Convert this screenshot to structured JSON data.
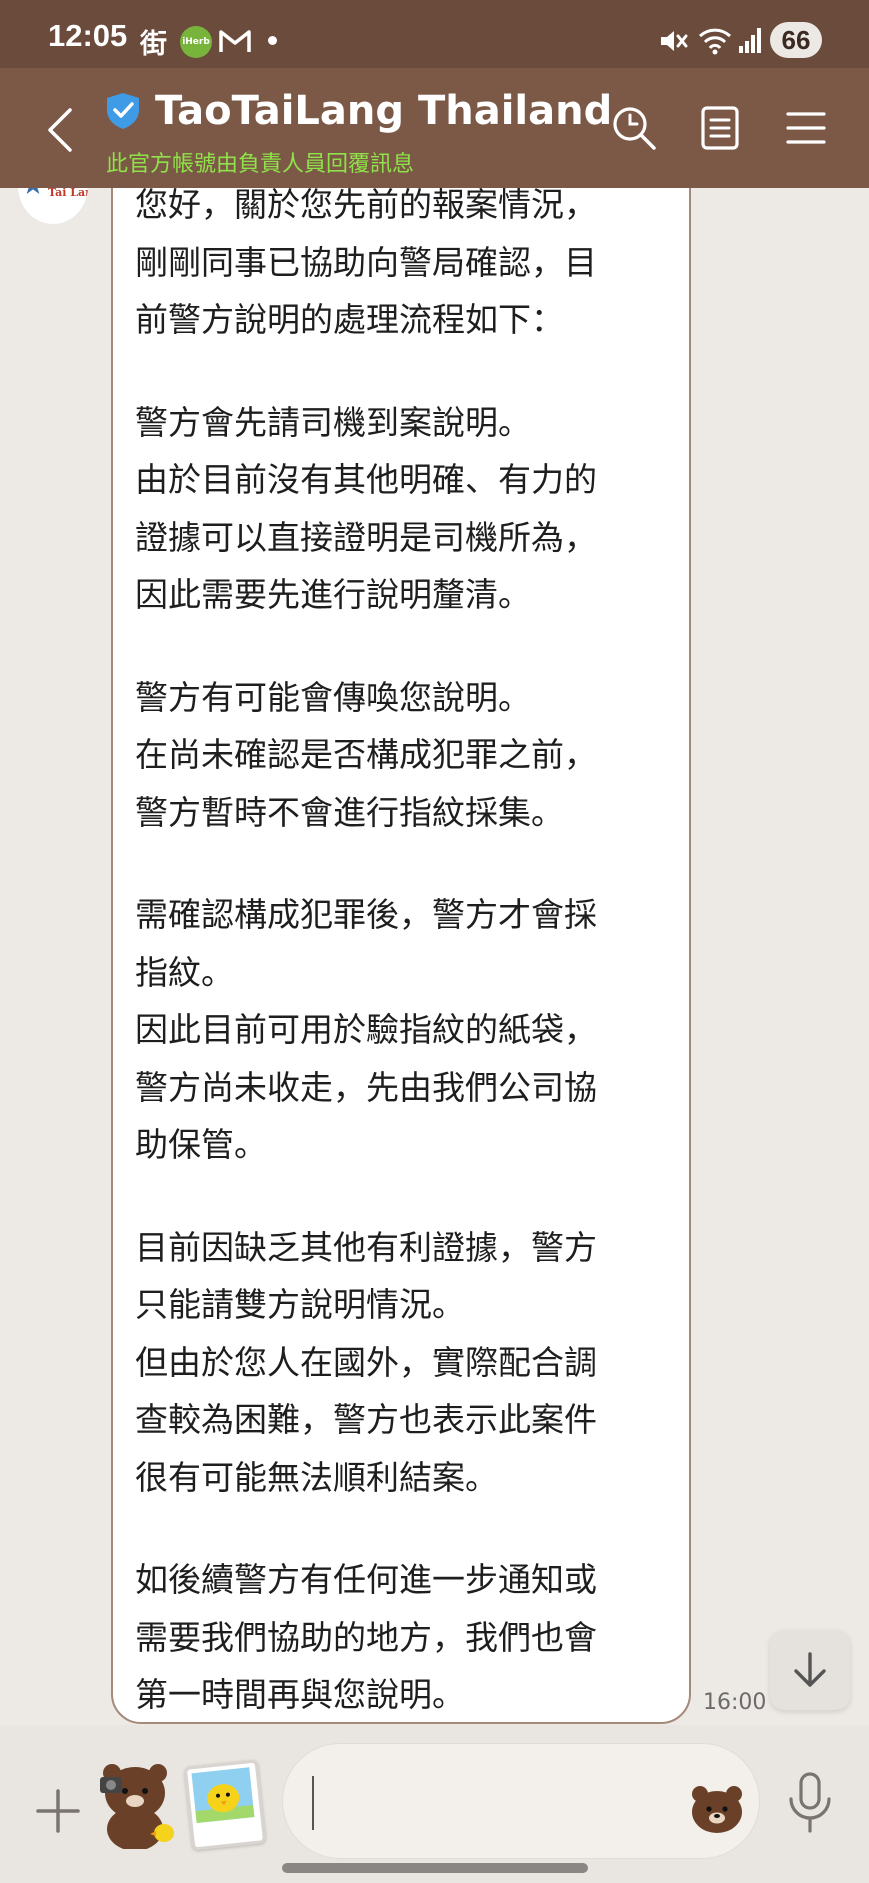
{
  "status_bar": {
    "time": "12:05",
    "tag": "街",
    "app_badge": "iHerb",
    "battery": "66"
  },
  "header": {
    "title": "TaoTaiLang Thailand",
    "subtitle": "此官方帳號由負責人員回覆訊息",
    "icons": [
      "back-icon",
      "verified-shield-icon",
      "search-icon",
      "notes-icon",
      "menu-icon"
    ]
  },
  "avatar": {
    "text": "Tai Lang"
  },
  "message": {
    "paragraphs": [
      [
        "您好，關於您先前的報案情況，",
        "剛剛同事已協助向警局確認，目",
        "前警方說明的處理流程如下："
      ],
      [
        "警方會先請司機到案說明。",
        "由於目前沒有其他明確、有力的",
        "證據可以直接證明是司機所為，",
        "因此需要先進行說明釐清。"
      ],
      [
        "警方有可能會傳喚您說明。",
        "在尚未確認是否構成犯罪之前，",
        "警方暫時不會進行指紋採集。"
      ],
      [
        "需確認構成犯罪後，警方才會採",
        "指紋。",
        "因此目前可用於驗指紋的紙袋，",
        "警方尚未收走，先由我們公司協",
        "助保管。"
      ],
      [
        "目前因缺乏其他有利證據，警方",
        "只能請雙方說明情況。",
        "但由於您人在國外，實際配合調",
        "查較為困難，警方也表示此案件",
        "很有可能無法順利結案。"
      ],
      [
        "如後續警方有任何進一步通知或",
        "需要我們協助的地方，我們也會",
        "第一時間再與您說明。"
      ]
    ],
    "time": "16:00"
  },
  "input_bar": {
    "value": "",
    "placeholder": "",
    "icons": [
      "plus-icon",
      "bear-sticker-icon",
      "photo-sticker-icon",
      "bear-emoji-icon",
      "microphone-icon"
    ]
  },
  "colors": {
    "header_bg": "#7c5846",
    "status_bg": "#6b4b3c",
    "subtitle_green": "#8fe24a",
    "chat_bg": "#ede9e4",
    "bubble_border": "#a48a7a"
  }
}
